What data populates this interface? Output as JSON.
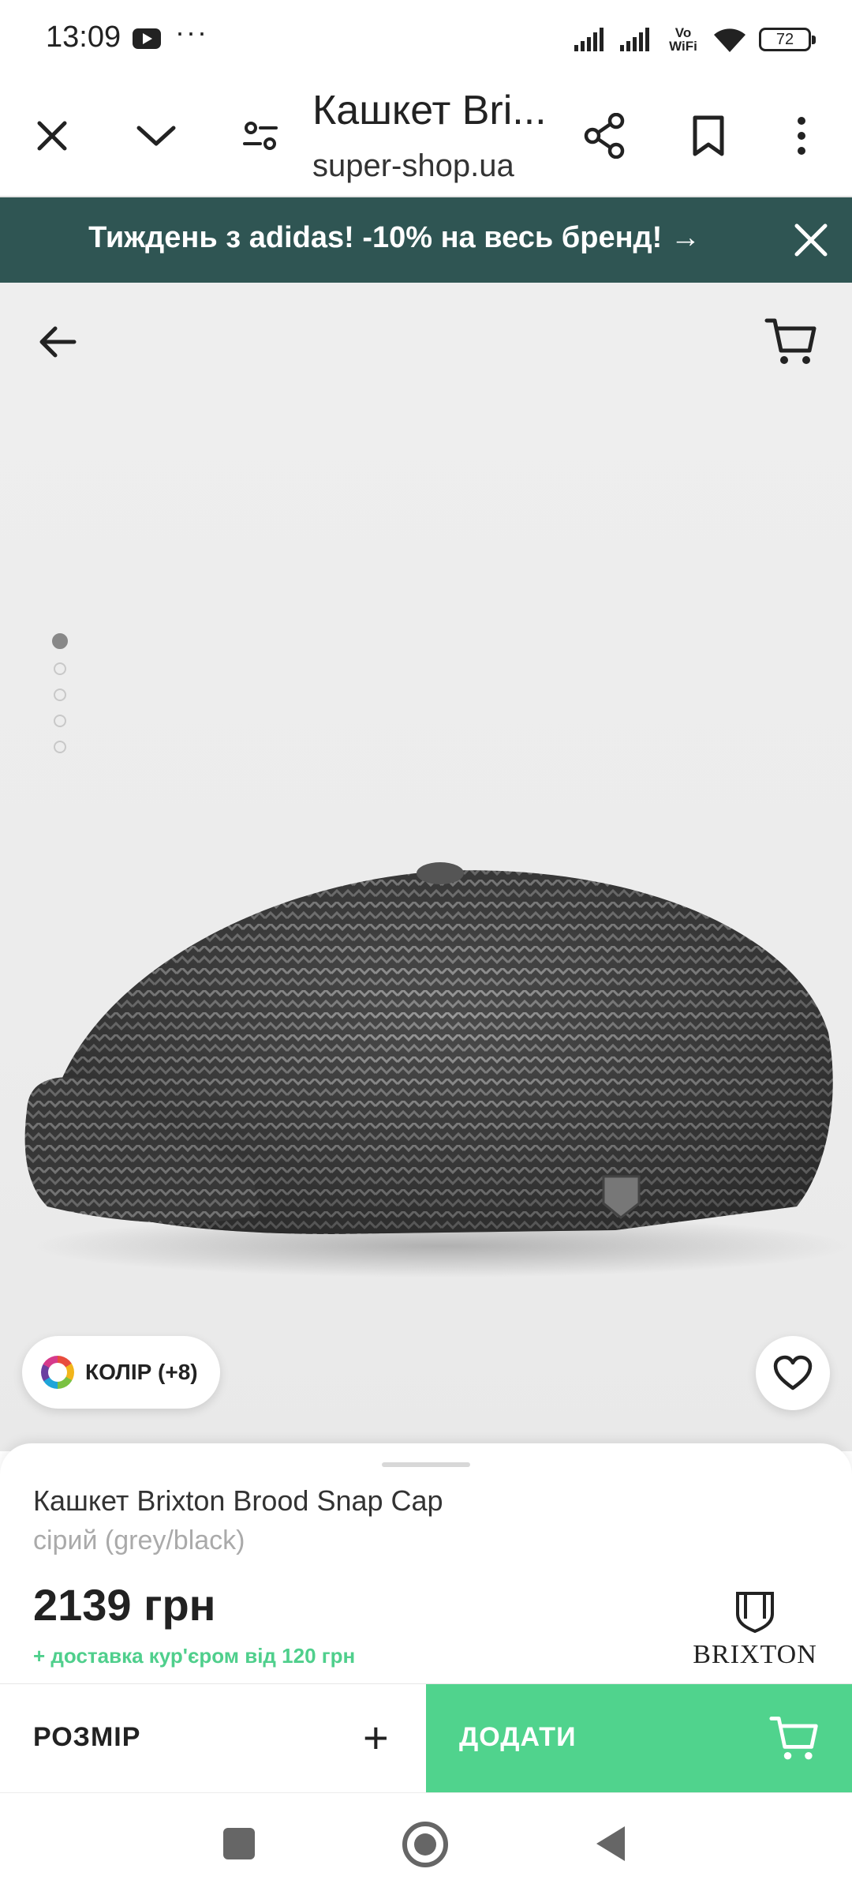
{
  "status": {
    "time": "13:09",
    "battery": "72",
    "wifi_label": "Vo WiFi",
    "icons": [
      "youtube-icon",
      "more-notifications-icon",
      "signal-icon",
      "signal-icon",
      "vowifi-icon",
      "wifi-icon",
      "battery-icon"
    ]
  },
  "toolbar": {
    "title": "Кашкет Bri...",
    "url": "super-shop.ua",
    "icons": [
      "close-icon",
      "chevron-down-icon",
      "tune-icon",
      "share-icon",
      "bookmark-icon",
      "more-vert-icon"
    ]
  },
  "promo": {
    "text": "Тиждень з adidas! -10% на весь бренд! →",
    "bg_color": "#2f5553"
  },
  "gallery": {
    "total_images": 5,
    "active_index": 0,
    "color_button": "КОЛІР (+8)"
  },
  "product": {
    "name": "Кашкет Brixton Brood Snap Cap",
    "color": "сірий (grey/black)",
    "price": "2139 грн",
    "delivery": "+ доставка кур'єром від 120 грн",
    "brand": "BRIXTON"
  },
  "actions": {
    "size_label": "РОЗМІР",
    "plus": "+",
    "add_label": "ДОДАТИ",
    "accent_color": "#50d38d"
  }
}
